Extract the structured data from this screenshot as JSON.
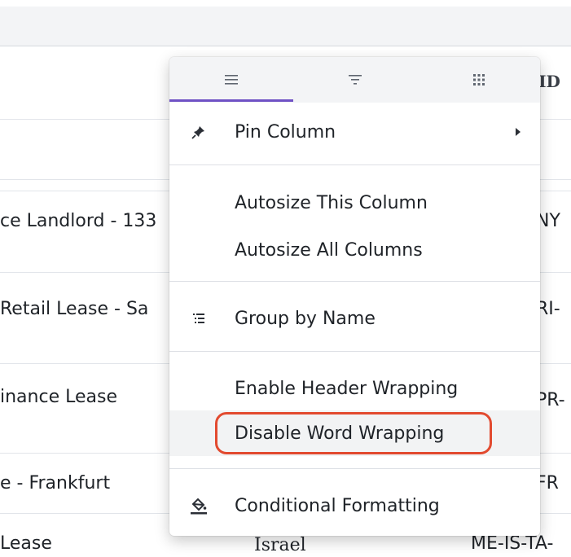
{
  "grid": {
    "header_partial": "t ID",
    "rows": [
      {
        "name": "ce Landlord - 133",
        "col2": "",
        "col3": "NY"
      },
      {
        "name": "Retail Lease - Sa",
        "col2": "",
        "col3": "RI-"
      },
      {
        "name": "inance Lease",
        "col2": "",
        "col3": "PR-"
      },
      {
        "name": "e - Frankfurt",
        "col2": "",
        "col3": "FR"
      },
      {
        "name": "Lease",
        "col2": "Israel",
        "col3": "ME-IS-TA-"
      }
    ]
  },
  "menu": {
    "tabs": [
      {
        "icon": "menu-lines-icon",
        "active": true
      },
      {
        "icon": "filter-icon",
        "active": false
      },
      {
        "icon": "columns-grid-icon",
        "active": false
      }
    ],
    "items": {
      "pin_column": "Pin Column",
      "autosize_this": "Autosize This Column",
      "autosize_all": "Autosize All Columns",
      "group_by": "Group by Name",
      "enable_header_wrapping": "Enable Header Wrapping",
      "disable_word_wrapping": "Disable Word Wrapping",
      "conditional_formatting": "Conditional Formatting"
    },
    "accent_color": "#6f52c5",
    "highlight_color": "#e24a2f"
  }
}
